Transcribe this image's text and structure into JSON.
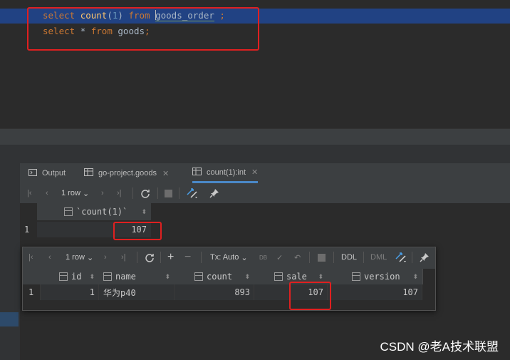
{
  "editor": {
    "line1": {
      "kw1": "select",
      "fn": "count",
      "num": "1",
      "kw2": "from",
      "table": "goods_order",
      "tail": ";"
    },
    "line2": {
      "kw1": "select",
      "star": "*",
      "kw2": "from",
      "table": "goods",
      "tail": ";"
    }
  },
  "tabs": [
    {
      "label": "Output",
      "icon": "console-icon"
    },
    {
      "label": "go-project.goods",
      "icon": "table-icon"
    },
    {
      "label": "count(1):int",
      "icon": "table-icon"
    }
  ],
  "toolbar1": {
    "rows": "1 row"
  },
  "result1": {
    "header": "`count(1)`",
    "row_num": "1",
    "value": "107"
  },
  "popup": {
    "toolbar": {
      "rows": "1 row",
      "tx": "Tx: Auto",
      "ddl": "DDL",
      "dml": "DML"
    },
    "columns": [
      "id",
      "name",
      "count",
      "sale",
      "version"
    ],
    "row": {
      "num": "1",
      "id": "1",
      "name": "华为p40",
      "count": "893",
      "sale": "107",
      "version": "107"
    }
  },
  "watermark": "CSDN @老A技术联盟"
}
